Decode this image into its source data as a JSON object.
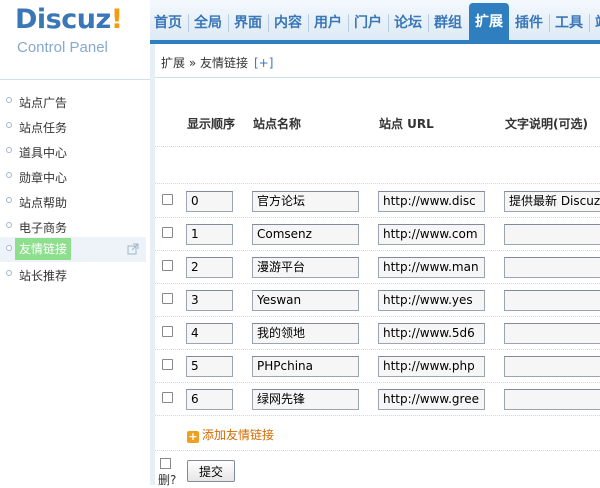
{
  "logo": {
    "brand": "Discuz",
    "bang": "!",
    "subtitle": "Control Panel"
  },
  "nav": {
    "tabs": [
      "首页",
      "全局",
      "界面",
      "内容",
      "用户",
      "门户",
      "论坛",
      "群组",
      "扩展",
      "插件",
      "工具",
      "站"
    ],
    "active": "扩展"
  },
  "sidebar": {
    "items": [
      "站点广告",
      "站点任务",
      "道具中心",
      "勋章中心",
      "站点帮助",
      "电子商务",
      "友情链接",
      "站长推荐"
    ],
    "active": "友情链接"
  },
  "breadcrumb": {
    "path": "扩展 » 友情链接",
    "add": "[+]"
  },
  "table": {
    "headers": {
      "order": "显示顺序",
      "name": "站点名称",
      "url": "站点 URL",
      "desc": "文字说明(可选)"
    },
    "rows": [
      {
        "order": "0",
        "name": "官方论坛",
        "url": "http://www.disc",
        "desc": "提供最新 Discuz"
      },
      {
        "order": "1",
        "name": "Comsenz",
        "url": "http://www.com",
        "desc": ""
      },
      {
        "order": "2",
        "name": "漫游平台",
        "url": "http://www.man",
        "desc": ""
      },
      {
        "order": "3",
        "name": "Yeswan",
        "url": "http://www.yes",
        "desc": ""
      },
      {
        "order": "4",
        "name": "我的领地",
        "url": "http://www.5d6",
        "desc": ""
      },
      {
        "order": "5",
        "name": "PHPchina",
        "url": "http://www.php",
        "desc": ""
      },
      {
        "order": "6",
        "name": "绿网先锋",
        "url": "http://www.gree",
        "desc": ""
      }
    ]
  },
  "footer": {
    "add_link": "添加友情链接",
    "delete_label": "删?",
    "submit": "提交"
  },
  "colors": {
    "brand": "#3a77b8",
    "accent": "#f39c12",
    "active_tab": "#2f7fc0",
    "active_side": "#8dde8d",
    "add_link": "#d26a00"
  }
}
